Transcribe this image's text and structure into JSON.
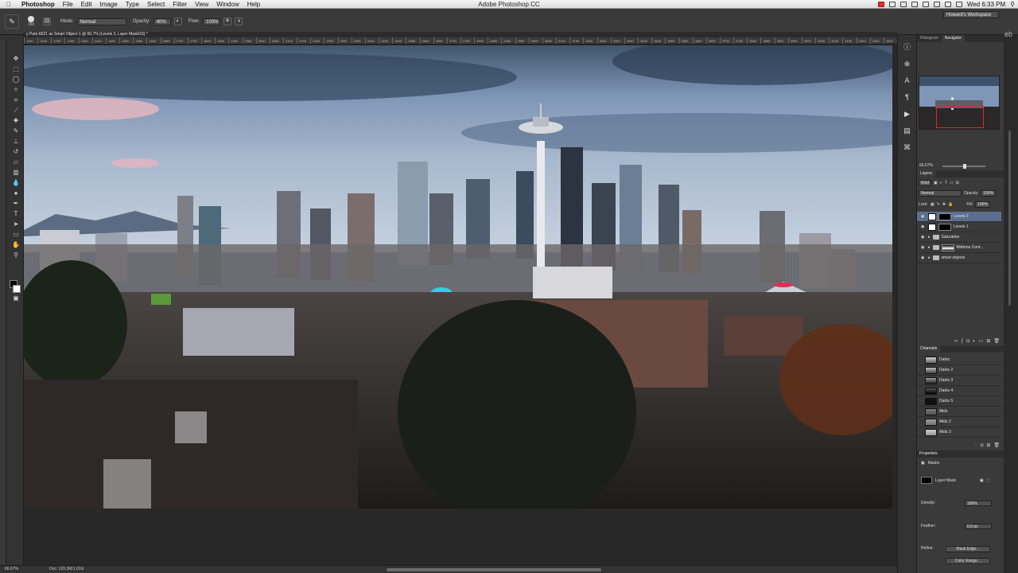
{
  "menubar": {
    "apple": "",
    "app_name": "Photoshop",
    "items": [
      "File",
      "Edit",
      "Image",
      "Type",
      "Select",
      "Filter",
      "View",
      "Window",
      "Help"
    ],
    "window_title": "Adobe Photoshop CC",
    "clock": "Wed 6:33 PM"
  },
  "options_bar": {
    "brush_size": "150",
    "mode_label": "Mode:",
    "mode_value": "Normal",
    "opacity_label": "Opacity:",
    "opacity_value": "40%",
    "flow_label": "Flow:",
    "flow_value": "100%",
    "workspace": "Howard's Workspace"
  },
  "document": {
    "tab_title": "y Park-6621 as Smart Object-1 @ 66.7% (Levels 2, Layer Mask/16) *",
    "ruler_ticks": [
      "1150",
      "1200",
      "1250",
      "1300",
      "1350",
      "1400",
      "1450",
      "1500",
      "1550",
      "1600",
      "1650",
      "1700",
      "1750",
      "1800",
      "1850",
      "1900",
      "1950",
      "2000",
      "2050",
      "2100",
      "2150",
      "2200",
      "2250",
      "2300",
      "2350",
      "2400",
      "2450",
      "2500",
      "2550",
      "2600",
      "2650",
      "2700",
      "2750",
      "2800",
      "2850",
      "2900",
      "2950",
      "3000",
      "3050",
      "3100",
      "3150",
      "3200",
      "3250",
      "3300",
      "3350",
      "3400",
      "3450",
      "3500",
      "3550",
      "3600",
      "3650",
      "3700",
      "3750",
      "3800",
      "3850",
      "3900",
      "3950",
      "4000",
      "4050",
      "4100",
      "4150",
      "4200",
      "4250",
      "4300"
    ]
  },
  "status_bar": {
    "zoom": "66.67%",
    "doc_info": "Doc: 120.3M/1.01G"
  },
  "navigator": {
    "tabs": [
      "Histogram",
      "Navigator"
    ],
    "zoom": "66.67%"
  },
  "layers": {
    "title": "Layers",
    "kind": "Kind",
    "blend_mode": "Normal",
    "opacity_label": "Opacity:",
    "opacity_value": "100%",
    "lock_label": "Lock:",
    "fill_label": "Fill:",
    "fill_value": "100%",
    "items": [
      {
        "name": "Levels 2"
      },
      {
        "name": "Levels 1"
      },
      {
        "name": "Saturation"
      },
      {
        "name": "Midtone Cont..."
      },
      {
        "name": "smart objects"
      }
    ]
  },
  "channels": {
    "title": "Channels",
    "items": [
      "Darks",
      "Darks 2",
      "Darks 3",
      "Darks 4",
      "Darks 5",
      "Mids",
      "Mids 2",
      "Mids 3"
    ]
  },
  "properties": {
    "title": "Properties",
    "section": "Masks",
    "mask_type": "Layer Mask",
    "density_label": "Density:",
    "density_value": "100%",
    "feather_label": "Feather:",
    "feather_value": "0.0 px",
    "refine_label": "Refine:",
    "mask_edge_button": "Mask Edge...",
    "color_range_button": "Color Range..."
  },
  "colors": {
    "selection": "#5a6f8f",
    "panel_bg": "#3a3a3a"
  }
}
